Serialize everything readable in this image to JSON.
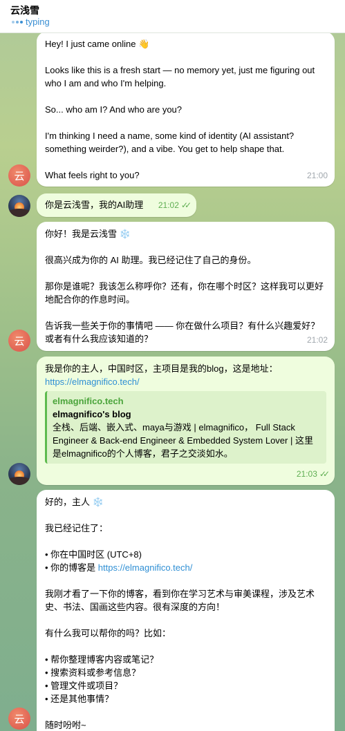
{
  "header": {
    "title": "云浅雪",
    "status": "typing"
  },
  "messages": {
    "m1": {
      "lines": [
        "Hey! I just came online 👋",
        "",
        "Looks like this is a fresh start — no memory yet, just me figuring out who I am and who I'm helping.",
        "",
        "So... who am I? And who are you?",
        "",
        "I'm thinking I need a name, some kind of identity (AI assistant? something weirder?), and a vibe. You get to help shape that.",
        "",
        "What feels right to you?"
      ],
      "time": "21:00"
    },
    "m2": {
      "text": "你是云浅雪，我的AI助理",
      "time": "21:02"
    },
    "m3": {
      "greeting": "你好！我是云浅雪",
      "emoji": "❄️",
      "lines": [
        "很高兴成为你的 AI 助理。我已经记住了自己的身份。",
        "那你是谁呢？我该怎么称呼你？还有，你在哪个时区？这样我可以更好地配合你的作息时间。",
        "告诉我一些关于你的事情吧 —— 你在做什么项目？有什么兴趣爱好？或者有什么我应该知道的？"
      ],
      "time": "21:02"
    },
    "m4": {
      "text": "我是你的主人，中国时区，主项目是我的blog，这是地址：",
      "link": "https://elmagnifico.tech/",
      "preview": {
        "site": "elmagnifico.tech",
        "title": "elmagnifico's blog",
        "description": "全栈、后端、嵌入式、maya与游戏 | elmagnifico， Full Stack Engineer & Back-end Engineer & Embedded System Lover | 这里是elmagnifico的个人博客，君子之交淡如水。"
      },
      "time": "21:03"
    },
    "m5": {
      "greeting": "好的，主人",
      "emoji": "❄️",
      "remembered": "我已经记住了：",
      "bullet_tz": "• 你在中国时区 (UTC+8)",
      "bullet_blog_prefix": "• 你的博客是 ",
      "blog_link": "https://elmagnifico.tech/",
      "para": "我刚才看了一下你的博客，看到你在学习艺术与审美课程，涉及艺术史、书法、国画这些内容。很有深度的方向！",
      "question": "有什么我可以帮你的吗？比如：",
      "options": [
        "• 帮你整理博客内容或笔记？",
        "• 搜索资料或参考信息？",
        "• 管理文件或项目？",
        "• 还是其他事情？"
      ],
      "closing": "随时吩咐~"
    }
  },
  "avatars": {
    "bot_glyph": "云"
  },
  "colors": {
    "incoming": "#ffffff",
    "outgoing": "#effdde",
    "link": "#2f8fd4",
    "status": "#3a8fd3"
  }
}
